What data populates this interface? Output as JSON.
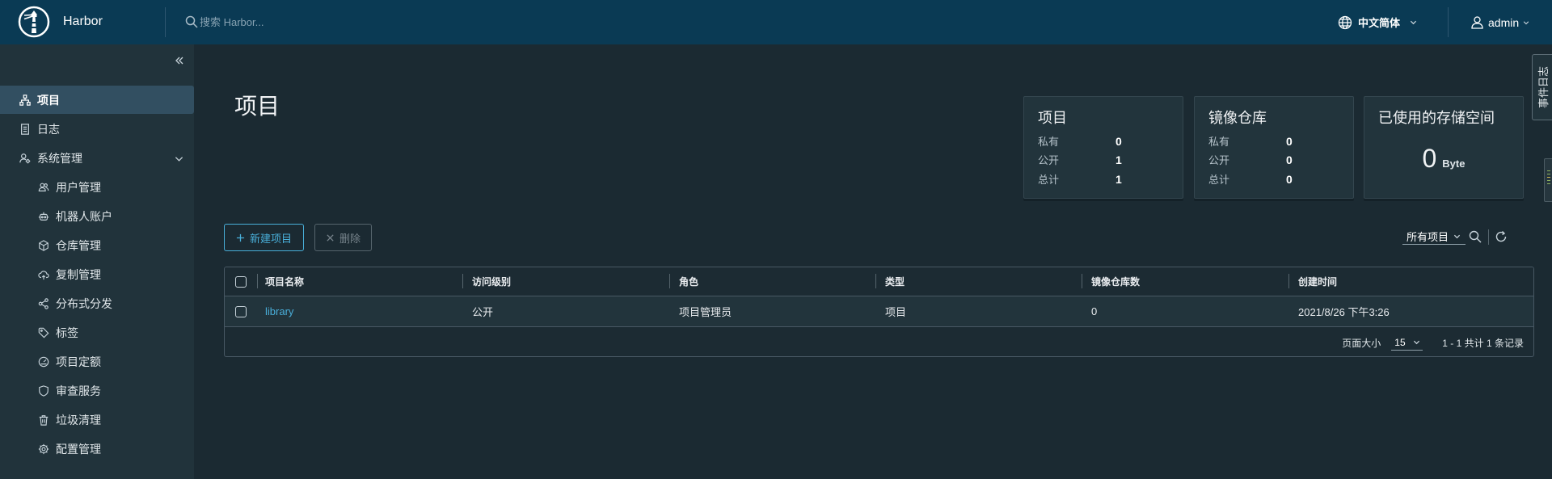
{
  "colors": {
    "header_bg": "#0a3a54",
    "sidebar_bg": "#21333b",
    "main_bg": "#1b2a32",
    "active_item_bg": "#324f61",
    "accent": "#49afd9",
    "link": "#4aaed9"
  },
  "header": {
    "app_name": "Harbor",
    "search_placeholder": "搜索 Harbor...",
    "language": "中文简体",
    "user": "admin"
  },
  "sidebar": {
    "items": [
      {
        "label": "项目",
        "icon": "projects-icon",
        "active": true
      },
      {
        "label": "日志",
        "icon": "logs-icon"
      },
      {
        "label": "系统管理",
        "icon": "system-admin-icon",
        "expanded": true
      },
      {
        "label": "用户管理",
        "icon": "users-icon"
      },
      {
        "label": "机器人账户",
        "icon": "robot-icon"
      },
      {
        "label": "仓库管理",
        "icon": "registry-icon"
      },
      {
        "label": "复制管理",
        "icon": "replication-icon"
      },
      {
        "label": "分布式分发",
        "icon": "distribution-icon"
      },
      {
        "label": "标签",
        "icon": "tag-icon"
      },
      {
        "label": "项目定额",
        "icon": "quota-icon"
      },
      {
        "label": "审查服务",
        "icon": "shield-icon"
      },
      {
        "label": "垃圾清理",
        "icon": "trash-icon"
      },
      {
        "label": "配置管理",
        "icon": "gear-icon"
      }
    ]
  },
  "page": {
    "title": "项目"
  },
  "summary": {
    "projects": {
      "title": "项目",
      "rows": [
        {
          "label": "私有",
          "value": "0"
        },
        {
          "label": "公开",
          "value": "1"
        },
        {
          "label": "总计",
          "value": "1"
        }
      ]
    },
    "repositories": {
      "title": "镜像仓库",
      "rows": [
        {
          "label": "私有",
          "value": "0"
        },
        {
          "label": "公开",
          "value": "0"
        },
        {
          "label": "总计",
          "value": "0"
        }
      ]
    },
    "storage": {
      "title": "已使用的存储空间",
      "value": "0",
      "unit": "Byte"
    }
  },
  "toolbar": {
    "new_project": "新建项目",
    "delete": "删除",
    "filter": "所有项目"
  },
  "table": {
    "columns": [
      "项目名称",
      "访问级别",
      "角色",
      "类型",
      "镜像仓库数",
      "创建时间"
    ],
    "rows": [
      {
        "name": "library",
        "access": "公开",
        "role": "项目管理员",
        "type": "项目",
        "repo_count": "0",
        "created": "2021/8/26 下午3:26"
      }
    ]
  },
  "pagination": {
    "page_size_label": "页面大小",
    "page_size": "15",
    "summary": "1 - 1 共计 1 条记录"
  },
  "event_log": {
    "label": "事件日志"
  }
}
